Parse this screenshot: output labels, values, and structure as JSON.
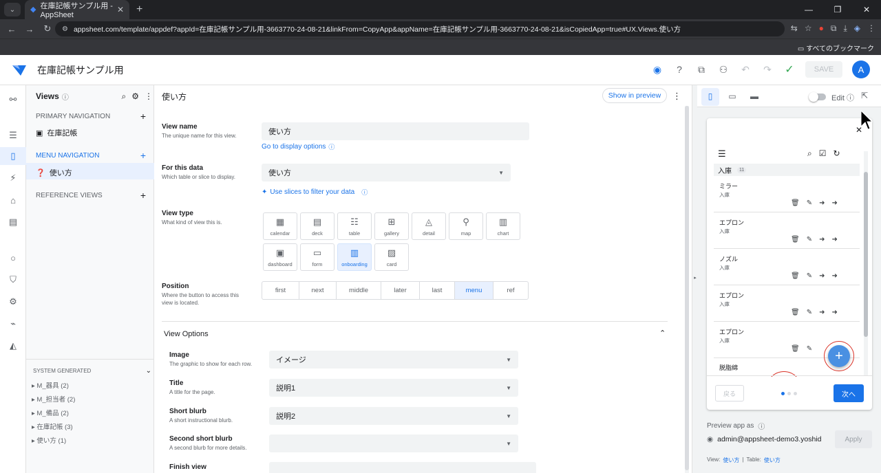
{
  "browser": {
    "tab_title": "在庫記帳サンプル用 - AppSheet",
    "url": "appsheet.com/template/appdef?appId=在庫記帳サンプル用-3663770-24-08-21&linkFrom=CopyApp&appName=在庫記帳サンプル用-3663770-24-08-21&isCopiedApp=true#UX.Views.使い方",
    "bookmarks_label": "すべてのブックマーク"
  },
  "app": {
    "title": "在庫記帳サンプル用",
    "avatar_letter": "A",
    "save_label": "SAVE"
  },
  "views_nav": {
    "header": "Views",
    "primary_label": "PRIMARY NAVIGATION",
    "primary_items": [
      "在庫記帳"
    ],
    "menu_label": "MENU NAVIGATION",
    "menu_items": [
      "使い方"
    ],
    "reference_label": "REFERENCE VIEWS",
    "system_label": "SYSTEM GENERATED",
    "system_items": [
      "M_器具 (2)",
      "M_担当者 (2)",
      "M_備品 (2)",
      "在庫記帳 (3)",
      "使い方 (1)"
    ]
  },
  "main": {
    "title": "使い方",
    "show_preview": "Show in preview",
    "view_name": {
      "label": "View name",
      "desc": "The unique name for this view.",
      "value": "使い方",
      "link": "Go to display options"
    },
    "for_data": {
      "label": "For this data",
      "desc": "Which table or slice to display.",
      "value": "使い方",
      "link": "Use slices to filter your data"
    },
    "view_type": {
      "label": "View type",
      "desc": "What kind of view this is.",
      "options": [
        "calendar",
        "deck",
        "table",
        "gallery",
        "detail",
        "map",
        "chart",
        "dashboard",
        "form",
        "onboarding",
        "card"
      ],
      "selected": "onboarding"
    },
    "position": {
      "label": "Position",
      "desc": "Where the button to access this view is located.",
      "options": [
        "first",
        "next",
        "middle",
        "later",
        "last",
        "menu",
        "ref"
      ],
      "selected": "menu"
    },
    "view_options": {
      "header": "View Options",
      "image": {
        "label": "Image",
        "desc": "The graphic to show for each row.",
        "value": "イメージ"
      },
      "title": {
        "label": "Title",
        "desc": "A title for the page.",
        "value": "説明1"
      },
      "short_blurb": {
        "label": "Short blurb",
        "desc": "A short instructional blurb.",
        "value": "説明2"
      },
      "second_blurb": {
        "label": "Second short blurb",
        "desc": "A second blurb for more details.",
        "value": ""
      },
      "finish_view": {
        "label": "Finish view"
      }
    }
  },
  "preview": {
    "edit_label": "Edit",
    "group_label": "入庫",
    "group_count": "11",
    "cards": [
      {
        "title": "ミラー",
        "sub": "入庫"
      },
      {
        "title": "エプロン",
        "sub": "入庫"
      },
      {
        "title": "ノズル",
        "sub": "入庫"
      },
      {
        "title": "エプロン",
        "sub": "入庫"
      },
      {
        "title": "エプロン",
        "sub": "入庫"
      }
    ],
    "peek_item": "脱脂綿",
    "back_label": "戻る",
    "next_label": "次へ",
    "preview_as_label": "Preview app as",
    "user_email": "admin@appsheet-demo3.yoshid",
    "apply_label": "Apply",
    "foot_view_label": "View:",
    "foot_view_value": "使い方",
    "foot_table_label": "Table:",
    "foot_table_value": "使い方"
  },
  "colors": {
    "accent": "#1a73e8",
    "ring": "#d93025",
    "fab": "#4a90e2"
  }
}
